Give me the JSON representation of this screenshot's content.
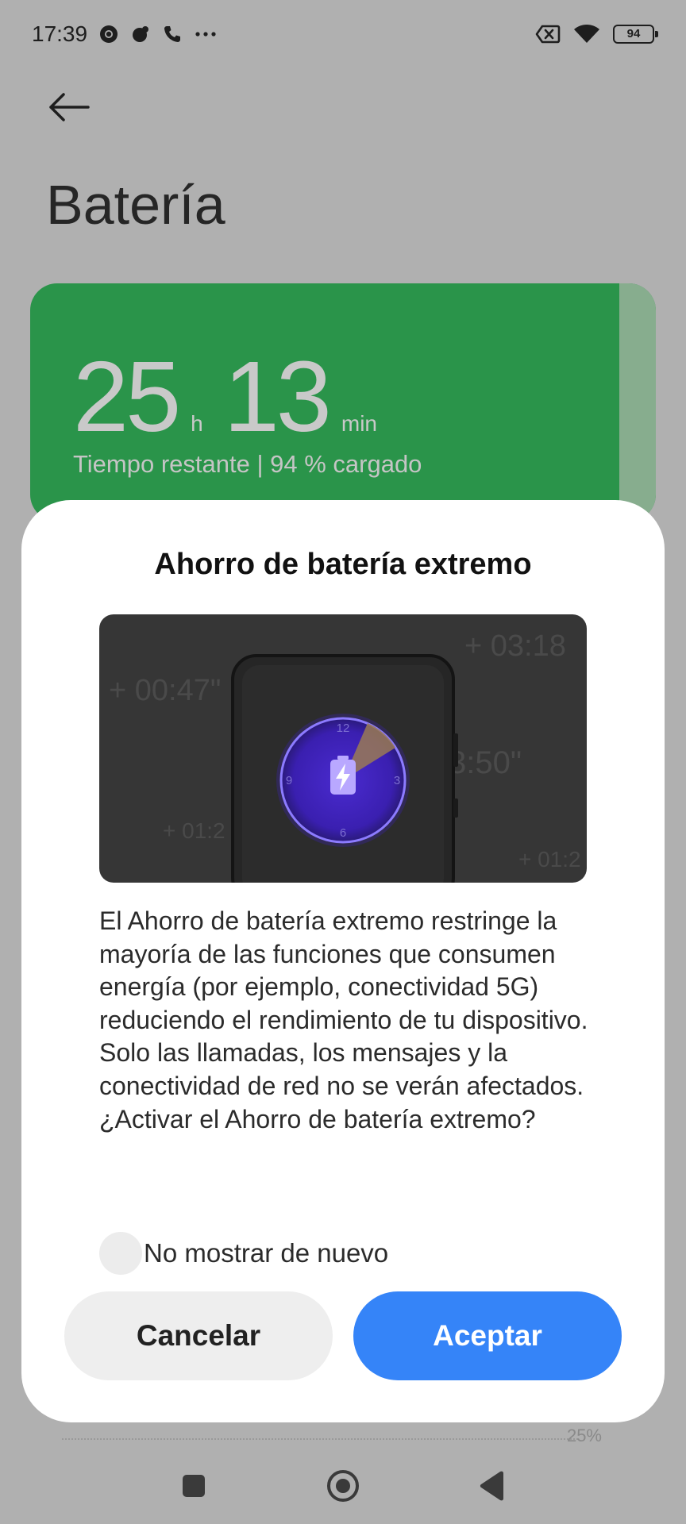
{
  "status_bar": {
    "time": "17:39",
    "icons": [
      "chrome-icon",
      "app-notification-icon",
      "phone-call-icon",
      "more-dots-icon"
    ],
    "right_icons": [
      "no-sim-icon",
      "wifi-icon",
      "battery-icon"
    ],
    "battery_level": "94"
  },
  "page": {
    "title": "Batería",
    "back_icon": "arrow-left-icon",
    "battery_card": {
      "hours": "25",
      "hours_unit": "h",
      "minutes": "13",
      "minutes_unit": "min",
      "subtitle": "Tiempo restante | 94 % cargado",
      "color": "#2a944a"
    },
    "chart_partial_label": "25%"
  },
  "dialog": {
    "title": "Ahorro de batería extremo",
    "illustration": {
      "overlay_texts": [
        "+ 00:47\"",
        "+ 03:18",
        "3:50\"",
        "+ 01:2",
        "+ 01:2"
      ],
      "clock_labels": [
        "12",
        "3",
        "6",
        "9"
      ]
    },
    "body": "El Ahorro de batería extremo restringe la mayoría de las funciones que consumen energía (por ejemplo, conectividad 5G) reduciendo el rendimiento de tu dispositivo. Solo las llamadas, los mensajes y la conectividad de red no se verán afectados. ¿Activar el Ahorro de batería extremo?",
    "checkbox_label": "No mostrar de nuevo",
    "checkbox_checked": false,
    "cancel_label": "Cancelar",
    "accept_label": "Aceptar",
    "accept_color": "#3584f8"
  },
  "nav_bar": {
    "buttons": [
      "recents-square-icon",
      "home-circle-icon",
      "back-triangle-icon"
    ]
  }
}
